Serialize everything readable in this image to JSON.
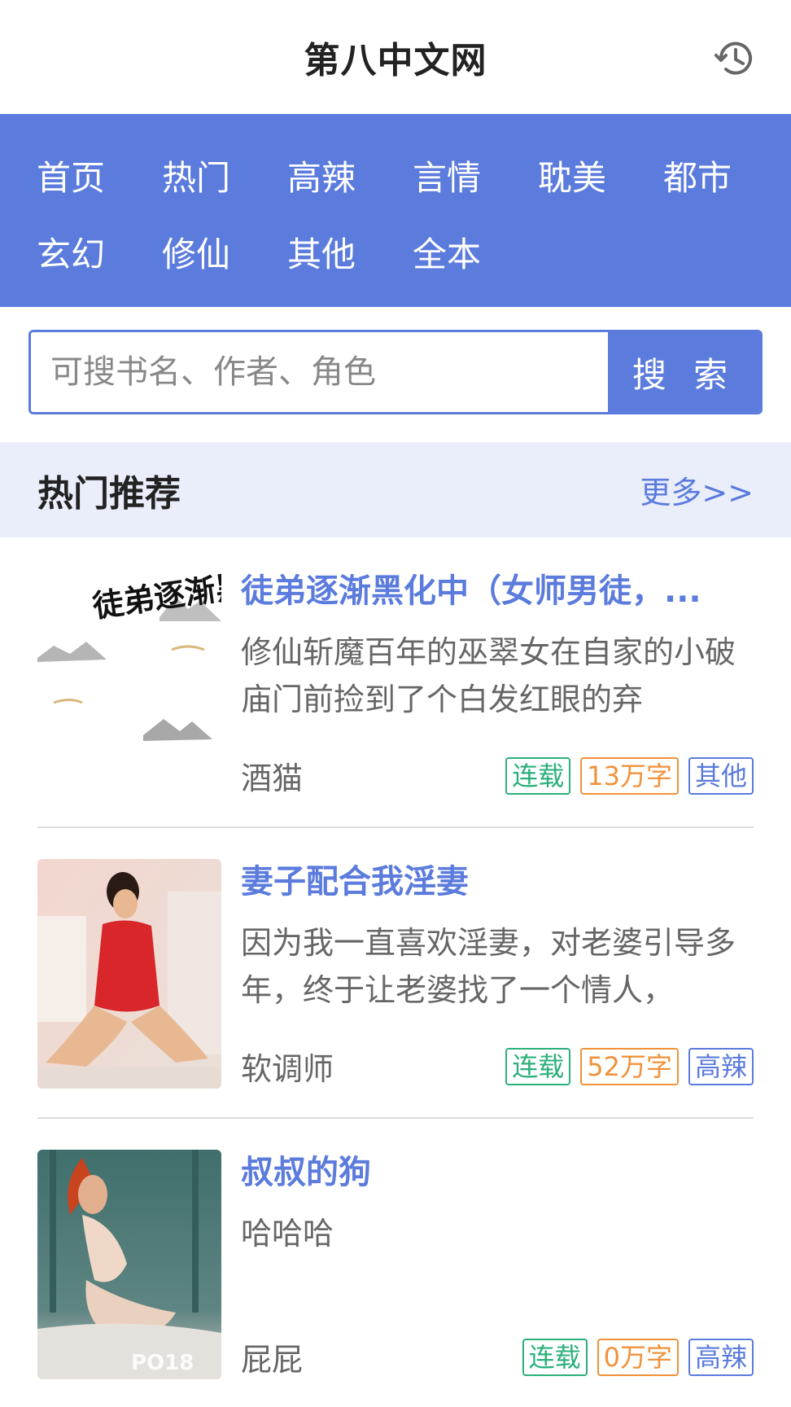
{
  "header": {
    "title": "第八中文网",
    "history_icon": "history-clock-icon"
  },
  "nav": {
    "row1": [
      {
        "label": "首页"
      },
      {
        "label": "热门"
      },
      {
        "label": "高辣"
      },
      {
        "label": "言情"
      },
      {
        "label": "耽美"
      },
      {
        "label": "都市"
      }
    ],
    "row2": [
      {
        "label": "玄幻"
      },
      {
        "label": "修仙"
      },
      {
        "label": "其他"
      },
      {
        "label": "全本"
      }
    ]
  },
  "search": {
    "placeholder": "可搜书名、作者、角色",
    "button_label": "搜 索"
  },
  "section": {
    "title": "热门推荐",
    "more_label": "更多>>"
  },
  "books": [
    {
      "title": "徒弟逐渐黑化中（女师男徒，...",
      "desc": "修仙斩魔百年的巫翠女在自家的小破庙门前捡到了个白发红眼的弃",
      "author": "酒猫",
      "status": "连载",
      "words": "13万字",
      "genre": "其他",
      "cover_text": "徒弟逐渐黑化中"
    },
    {
      "title": "妻子配合我淫妻",
      "desc": "因为我一直喜欢淫妻，对老婆引导多年，终于让老婆找了一个情人，",
      "author": "软调师",
      "status": "连载",
      "words": "52万字",
      "genre": "高辣"
    },
    {
      "title": "叔叔的狗",
      "desc": "哈哈哈",
      "author": "屁屁",
      "status": "连载",
      "words": "0万字",
      "genre": "高辣",
      "cover_text": "PO18"
    }
  ],
  "colors": {
    "accent": "#5b7bdd",
    "status": "#2bb07a",
    "words": "#f0923a",
    "section_bg": "#e9eefa"
  }
}
